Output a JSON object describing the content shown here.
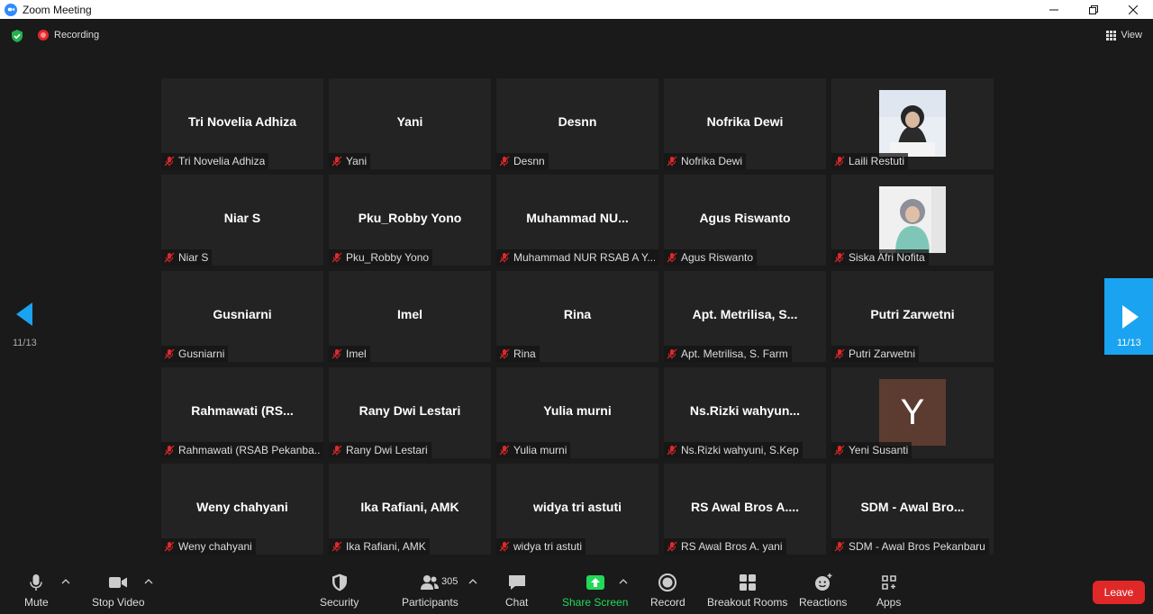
{
  "window": {
    "title": "Zoom Meeting"
  },
  "topbar": {
    "recording_label": "Recording",
    "view_label": "View"
  },
  "pager": {
    "left_page": "11/13",
    "right_page": "11/13"
  },
  "tiles": [
    {
      "name": "Tri Novelia Adhiza",
      "label": "Tri Novelia Adhiza"
    },
    {
      "name": "Yani",
      "label": "Yani"
    },
    {
      "name": "Desnn",
      "label": "Desnn"
    },
    {
      "name": "Nofrika Dewi",
      "label": "Nofrika Dewi"
    },
    {
      "name": "",
      "label": "Laili Restuti"
    },
    {
      "name": "Niar S",
      "label": "Niar S"
    },
    {
      "name": "Pku_Robby Yono",
      "label": "Pku_Robby Yono"
    },
    {
      "name": "Muhammad  NU...",
      "label": "Muhammad NUR RSAB A Y..."
    },
    {
      "name": "Agus Riswanto",
      "label": "Agus Riswanto"
    },
    {
      "name": "",
      "label": "Siska Afri Nofita"
    },
    {
      "name": "Gusniarni",
      "label": "Gusniarni"
    },
    {
      "name": "Imel",
      "label": "Imel"
    },
    {
      "name": "Rina",
      "label": "Rina"
    },
    {
      "name": "Apt.  Metrilisa,  S...",
      "label": "Apt. Metrilisa, S. Farm"
    },
    {
      "name": "Putri Zarwetni",
      "label": "Putri Zarwetni"
    },
    {
      "name": "Rahmawati   (RS...",
      "label": "Rahmawati  (RSAB Pekanba..."
    },
    {
      "name": "Rany Dwi Lestari",
      "label": "Rany Dwi Lestari"
    },
    {
      "name": "Yulia murni",
      "label": "Yulia murni"
    },
    {
      "name": "Ns.Rizki  wahyun...",
      "label": "Ns.Rizki wahyuni, S.Kep"
    },
    {
      "name": "",
      "label": "Yeni Susanti",
      "avatar": "Y"
    },
    {
      "name": "Weny chahyani",
      "label": "Weny chahyani"
    },
    {
      "name": "Ika Rafiani, AMK",
      "label": "Ika Rafiani, AMK"
    },
    {
      "name": "widya tri astuti",
      "label": "widya tri astuti"
    },
    {
      "name": "RS Awal Bros A....",
      "label": "RS Awal Bros A. yani"
    },
    {
      "name": "SDM  -  Awal Bro...",
      "label": "SDM - Awal Bros Pekanbaru"
    }
  ],
  "toolbar": {
    "mute": "Mute",
    "stop_video": "Stop Video",
    "security": "Security",
    "participants": "Participants",
    "participants_count": "305",
    "chat": "Chat",
    "share_screen": "Share Screen",
    "record": "Record",
    "breakout_rooms": "Breakout Rooms",
    "reactions": "Reactions",
    "apps": "Apps",
    "leave": "Leave"
  },
  "colors": {
    "accent_blue": "#1aa3f0",
    "share_green": "#23d959",
    "leave_red": "#e02828",
    "tile_bg": "#232323",
    "avatar_brown": "#5c3c31"
  }
}
